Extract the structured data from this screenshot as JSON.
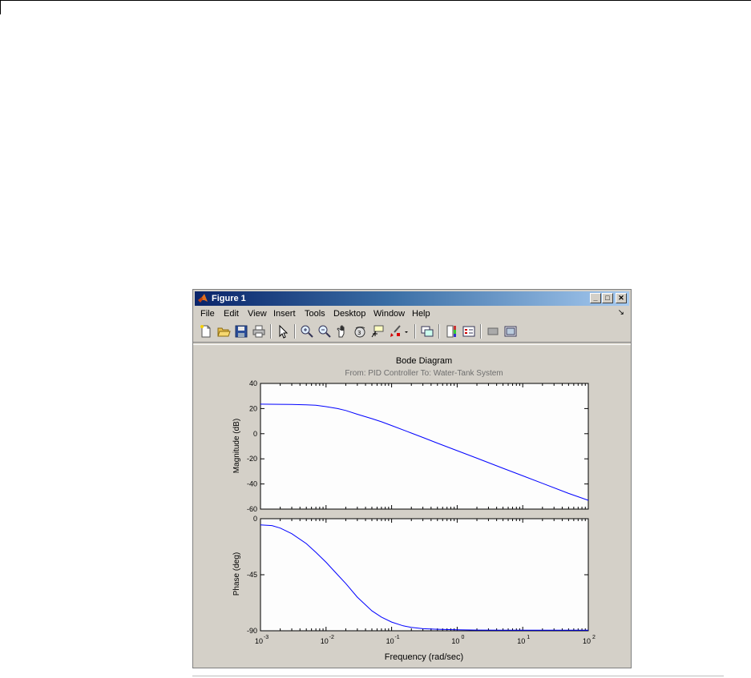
{
  "window": {
    "title": "Figure 1",
    "controls": {
      "minimize": "_",
      "maximize": "□",
      "close": "✕"
    }
  },
  "menubar": {
    "items": [
      "File",
      "Edit",
      "View",
      "Insert",
      "Tools",
      "Desktop",
      "Window",
      "Help"
    ],
    "grip_glyph": "↘"
  },
  "toolbar": {
    "buttons": [
      "new-figure-icon",
      "open-file-icon",
      "save-icon",
      "print-icon",
      "edit-plot-icon",
      "zoom-in-icon",
      "zoom-out-icon",
      "pan-icon",
      "rotate-3d-icon",
      "data-cursor-icon",
      "brush-icon",
      "brush-dropdown-icon",
      "link-plot-icon",
      "colorbar-icon",
      "legend-icon",
      "hide-plot-tools-icon",
      "show-plot-tools-icon"
    ]
  },
  "chart_data": {
    "type": "line",
    "title": "Bode Diagram",
    "subtitle": "From: PID Controller  To: Water-Tank System",
    "xlabel": "Frequency  (rad/sec)",
    "xscale": "log",
    "xlim": [
      0.001,
      100
    ],
    "x_tick_labels": [
      "10",
      "10",
      "10",
      "10",
      "10",
      "10"
    ],
    "x_tick_exponents": [
      "-3",
      "-2",
      "-1",
      "0",
      "1",
      "2"
    ],
    "grid": false,
    "panels": [
      {
        "ylabel": "Magnitude (dB)",
        "ylim": [
          -60,
          40
        ],
        "y_ticks": [
          40,
          20,
          0,
          -20,
          -40,
          -60
        ],
        "series": [
          {
            "color": "#0000ff",
            "x": [
              0.001,
              0.002,
              0.003,
              0.005,
              0.007,
              0.01,
              0.015,
              0.02,
              0.03,
              0.05,
              0.07,
              0.1,
              0.2,
              0.3,
              0.5,
              1,
              2,
              5,
              10,
              20,
              50,
              100
            ],
            "y": [
              23.5,
              23.4,
              23.3,
              23.0,
              22.6,
              21.5,
              20.0,
              18.5,
              15.5,
              12.0,
              9.5,
              6.5,
              0.5,
              -3.0,
              -7.5,
              -13.5,
              -19.5,
              -27.5,
              -33.5,
              -39.5,
              -47.5,
              -53.0
            ]
          }
        ]
      },
      {
        "ylabel": "Phase (deg)",
        "ylim": [
          -90,
          0
        ],
        "y_ticks": [
          0,
          -45,
          -90
        ],
        "series": [
          {
            "color": "#0000ff",
            "x": [
              0.001,
              0.0015,
              0.002,
              0.003,
              0.005,
              0.007,
              0.01,
              0.015,
              0.02,
              0.03,
              0.05,
              0.07,
              0.1,
              0.15,
              0.2,
              0.3,
              0.5,
              1,
              2,
              5,
              10,
              100
            ],
            "y": [
              -5,
              -5.5,
              -7.5,
              -12,
              -20,
              -27,
              -35,
              -45,
              -52,
              -63,
              -74,
              -79,
              -83,
              -86,
              -87.3,
              -88.3,
              -88.8,
              -89.2,
              -89.4,
              -89.5,
              -89.5,
              -89.5
            ]
          }
        ]
      }
    ]
  }
}
